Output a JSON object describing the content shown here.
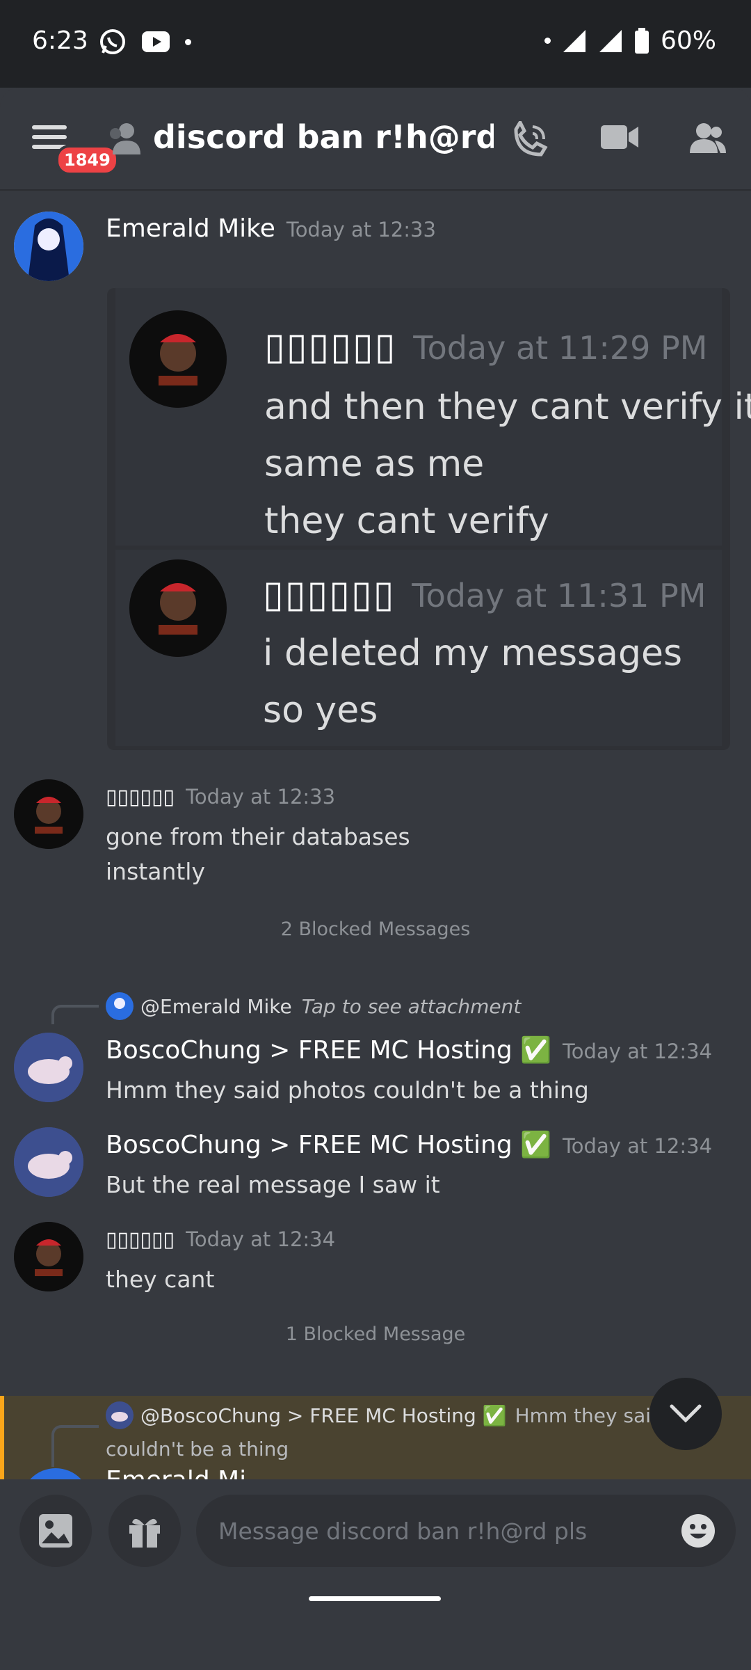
{
  "status": {
    "time": "6:23",
    "battery": "60%"
  },
  "toolbar": {
    "badge": "1849",
    "channel_title": "discord ban r!h@rd ..."
  },
  "msg1": {
    "author": "Emerald Mike",
    "timestamp": "Today at 12:33"
  },
  "embed": {
    "items": [
      {
        "author": "▯▯▯▯▯▯",
        "timestamp": "Today at 11:29 PM",
        "lines": [
          "and then they cant verify it",
          "same as me",
          "they cant verify"
        ]
      },
      {
        "author": "▯▯▯▯▯▯",
        "timestamp": "Today at 11:31 PM",
        "lines": [
          "i deleted my messages",
          "so yes"
        ]
      }
    ]
  },
  "msg2": {
    "author": "▯▯▯▯▯▯",
    "timestamp": "Today at 12:33",
    "lines": [
      "gone from their databases",
      "instantly"
    ]
  },
  "blocked1": "2 Blocked Messages",
  "reply1": {
    "mention": "@Emerald Mike",
    "preview": "Tap to see attachment"
  },
  "msg3": {
    "author": "BoscoChung > FREE MC Hosting ✅",
    "timestamp": "Today at 12:34",
    "text": "Hmm they said photos couldn't be a thing"
  },
  "msg4": {
    "author": "BoscoChung > FREE MC Hosting ✅",
    "timestamp": "Today at 12:34",
    "text": "But the real message I saw it"
  },
  "msg5": {
    "author": "▯▯▯▯▯▯",
    "timestamp": "Today at 12:34",
    "text": "they cant"
  },
  "blocked2": "1 Blocked Message",
  "reply2": {
    "mention": "@BoscoChung > FREE MC Hosting ✅",
    "preview": "Hmm they said",
    "preview2": "couldn't be a thing",
    "next_author_partial": "Emerald Mi"
  },
  "composer": {
    "placeholder": "Message discord ban r!h@rd pls"
  },
  "colors": {
    "background": "#36393f",
    "badge": "#ed4245",
    "mention_highlight": "#faa61a"
  }
}
